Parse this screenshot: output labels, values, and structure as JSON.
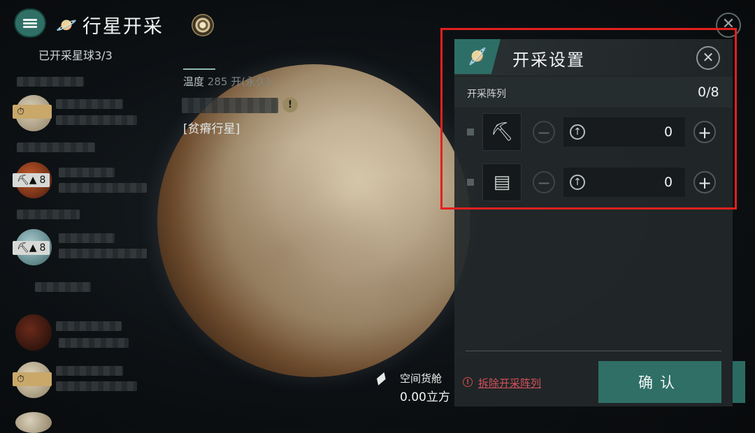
{
  "header": {
    "title": "行星开采",
    "subtitle": "已开采星球3/3"
  },
  "planet_list": {
    "tags": [
      {
        "icon": "clock-icon",
        "text": ""
      },
      {
        "icon": "pickaxe-icon",
        "text": "8"
      },
      {
        "icon": "pickaxe-icon",
        "text": "8"
      },
      {
        "icon": "clock-icon",
        "text": ""
      }
    ]
  },
  "planet": {
    "temperature_label": "温度",
    "temperature_value": "285 开(永久)",
    "type": "[贫瘠行星]"
  },
  "cargo": {
    "label": "空间货舱",
    "value": "0.00立方"
  },
  "mining_panel": {
    "title": "开采设置",
    "array_label": "开采阵列",
    "array_count": "0/8",
    "rows": [
      {
        "icon": "drill-icon",
        "quantity": "0"
      },
      {
        "icon": "ore-crate-icon",
        "quantity": "0"
      }
    ],
    "dismantle_label": "拆除开采阵列",
    "confirm_label": "确认"
  },
  "colors": {
    "accent": "#2f6f66",
    "highlight": "#e3201e",
    "warning": "#d8505a"
  }
}
